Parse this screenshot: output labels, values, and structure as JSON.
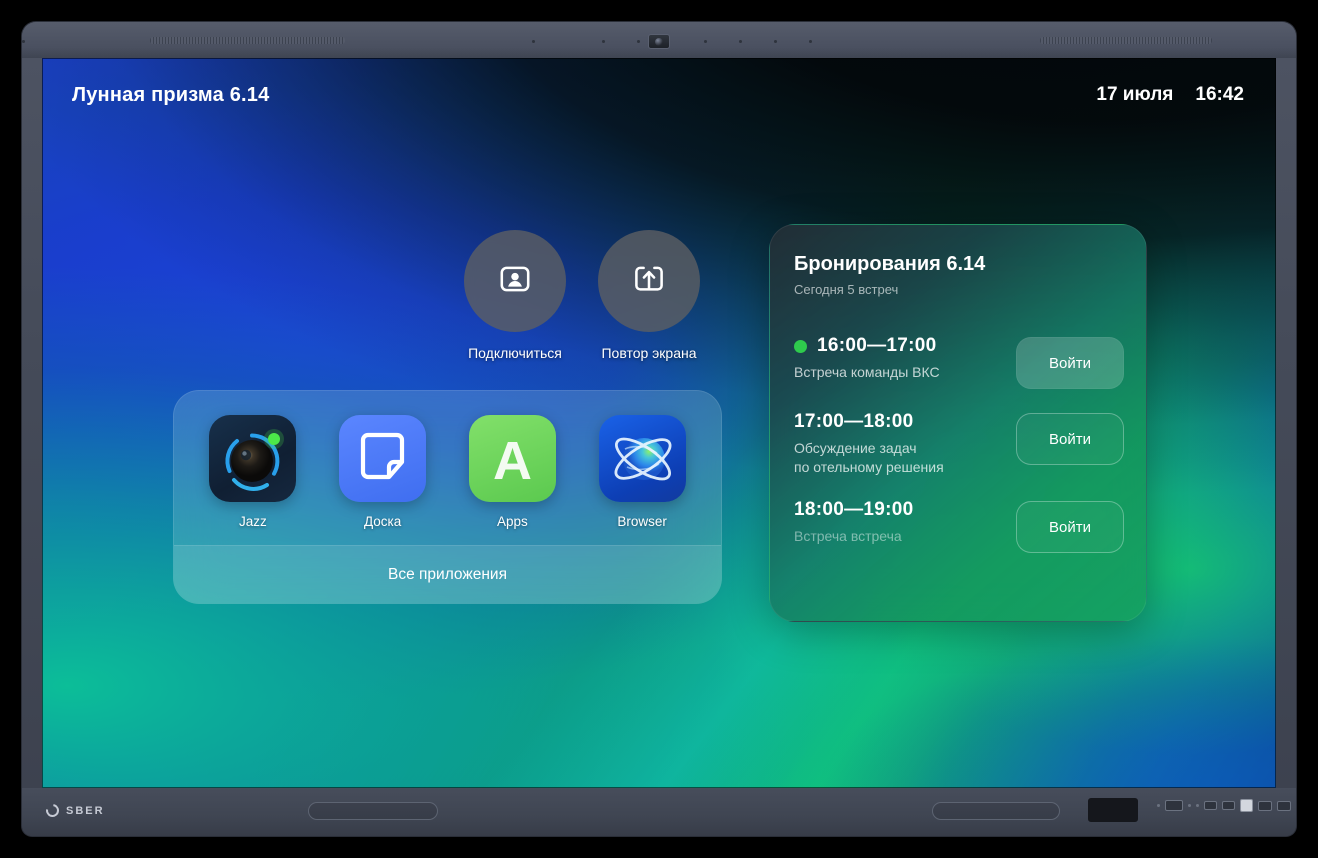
{
  "statusbar": {
    "room_title": "Лунная призма 6.14",
    "date": "17 июля",
    "time": "16:42"
  },
  "quick_actions": [
    {
      "label": "Подключиться",
      "icon": "person-in-frame-icon"
    },
    {
      "label": "Повтор экрана",
      "icon": "screen-share-icon"
    }
  ],
  "dock": {
    "apps": [
      {
        "label": "Jazz",
        "icon": "camera-lens-icon"
      },
      {
        "label": "Доска",
        "icon": "sticky-note-icon"
      },
      {
        "label": "Apps",
        "icon": "letter-a-icon"
      },
      {
        "label": "Browser",
        "icon": "globe-orbit-icon"
      }
    ],
    "all_apps_label": "Все приложения"
  },
  "bookings": {
    "title": "Бронирования 6.14",
    "subtitle": "Сегодня 5 встреч",
    "meetings": [
      {
        "time": "16:00—17:00",
        "name": "Встреча команды ВКС",
        "status": "active",
        "dot_color": "#2ecb4d",
        "button_label": "Войти",
        "button_style": "filled"
      },
      {
        "time": "17:00—18:00",
        "name": "Обсуждение задач\nпо отельному решения",
        "status": "upcoming",
        "button_label": "Войти",
        "button_style": "ghost"
      },
      {
        "time": "18:00—19:00",
        "name": "Встреча встреча",
        "status": "later",
        "button_label": "Войти",
        "button_style": "ghost"
      }
    ]
  },
  "device": {
    "brand": "SBER"
  },
  "colors": {
    "accent_green": "#2ecb4d",
    "wallpaper_blue": "#1b3ec9",
    "wallpaper_teal": "#0bc496",
    "panel_green": "#16a05c"
  }
}
